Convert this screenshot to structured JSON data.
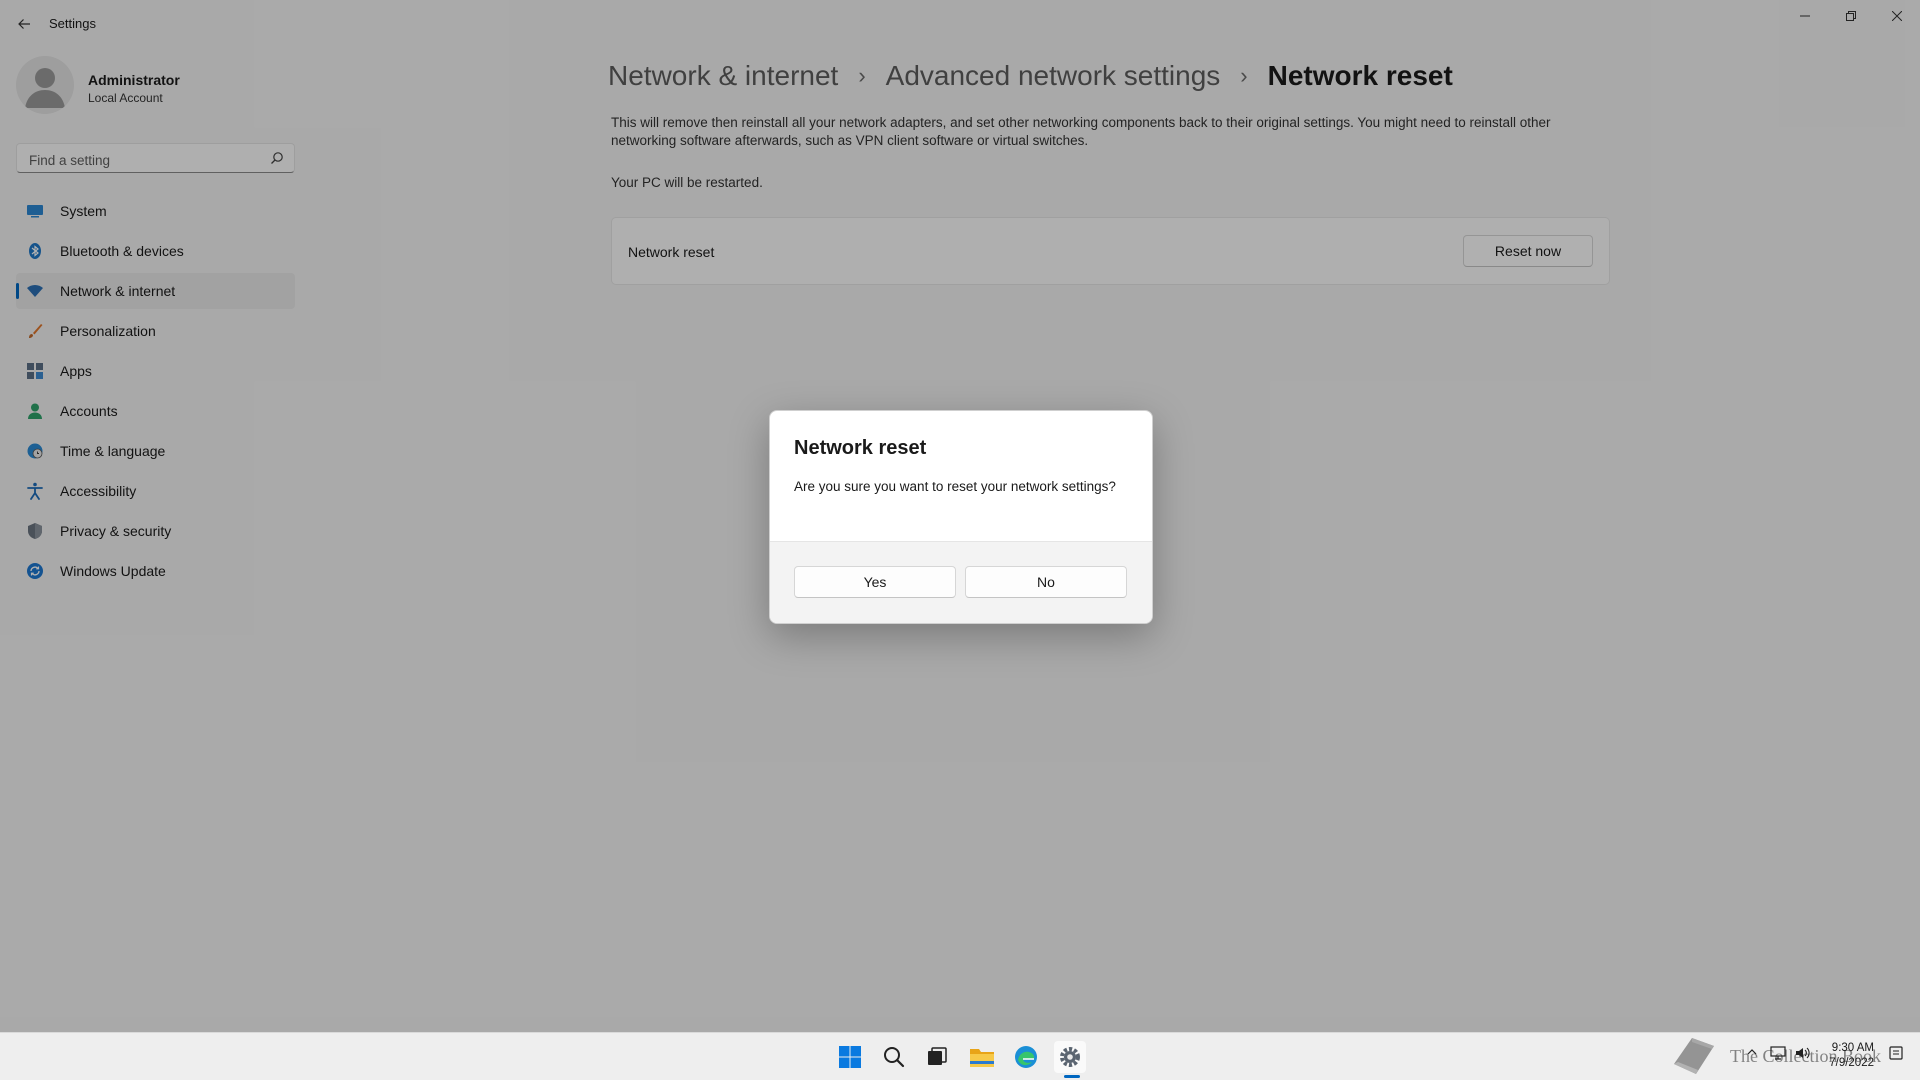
{
  "window": {
    "title": "Settings",
    "controls": [
      "minimize",
      "restore",
      "close"
    ]
  },
  "profile": {
    "name": "Administrator",
    "account_type": "Local Account"
  },
  "search": {
    "placeholder": "Find a setting"
  },
  "sidebar": {
    "items": [
      {
        "label": "System",
        "icon": "system-icon",
        "active": false
      },
      {
        "label": "Bluetooth & devices",
        "icon": "bluetooth-icon",
        "active": false
      },
      {
        "label": "Network & internet",
        "icon": "wifi-icon",
        "active": true
      },
      {
        "label": "Personalization",
        "icon": "brush-icon",
        "active": false
      },
      {
        "label": "Apps",
        "icon": "apps-icon",
        "active": false
      },
      {
        "label": "Accounts",
        "icon": "person-icon",
        "active": false
      },
      {
        "label": "Time & language",
        "icon": "globe-clock-icon",
        "active": false
      },
      {
        "label": "Accessibility",
        "icon": "accessibility-icon",
        "active": false
      },
      {
        "label": "Privacy & security",
        "icon": "shield-icon",
        "active": false
      },
      {
        "label": "Windows Update",
        "icon": "update-icon",
        "active": false
      }
    ]
  },
  "breadcrumb": {
    "items": [
      "Network & internet",
      "Advanced network settings",
      "Network reset"
    ]
  },
  "main": {
    "description": "This will remove then reinstall all your network adapters, and set other networking components back to their original settings. You might need to reinstall other networking software afterwards, such as VPN client software or virtual switches.",
    "restart_note": "Your PC will be restarted.",
    "card": {
      "label": "Network reset",
      "button": "Reset now"
    }
  },
  "dialog": {
    "title": "Network reset",
    "message": "Are you sure you want to reset your network settings?",
    "yes_label": "Yes",
    "no_label": "No"
  },
  "taskbar": {
    "apps": [
      "start-icon",
      "search-icon",
      "task-view-icon",
      "file-explorer-icon",
      "edge-icon",
      "settings-icon"
    ],
    "active_app": "settings-icon",
    "time": "9:30 AM",
    "date": "7/9/2022",
    "watermark_text": "The Collection Book"
  },
  "colors": {
    "accent": "#0067c0",
    "background": "#f3f3f3",
    "overlay": "rgba(0,0,0,0.30)"
  }
}
